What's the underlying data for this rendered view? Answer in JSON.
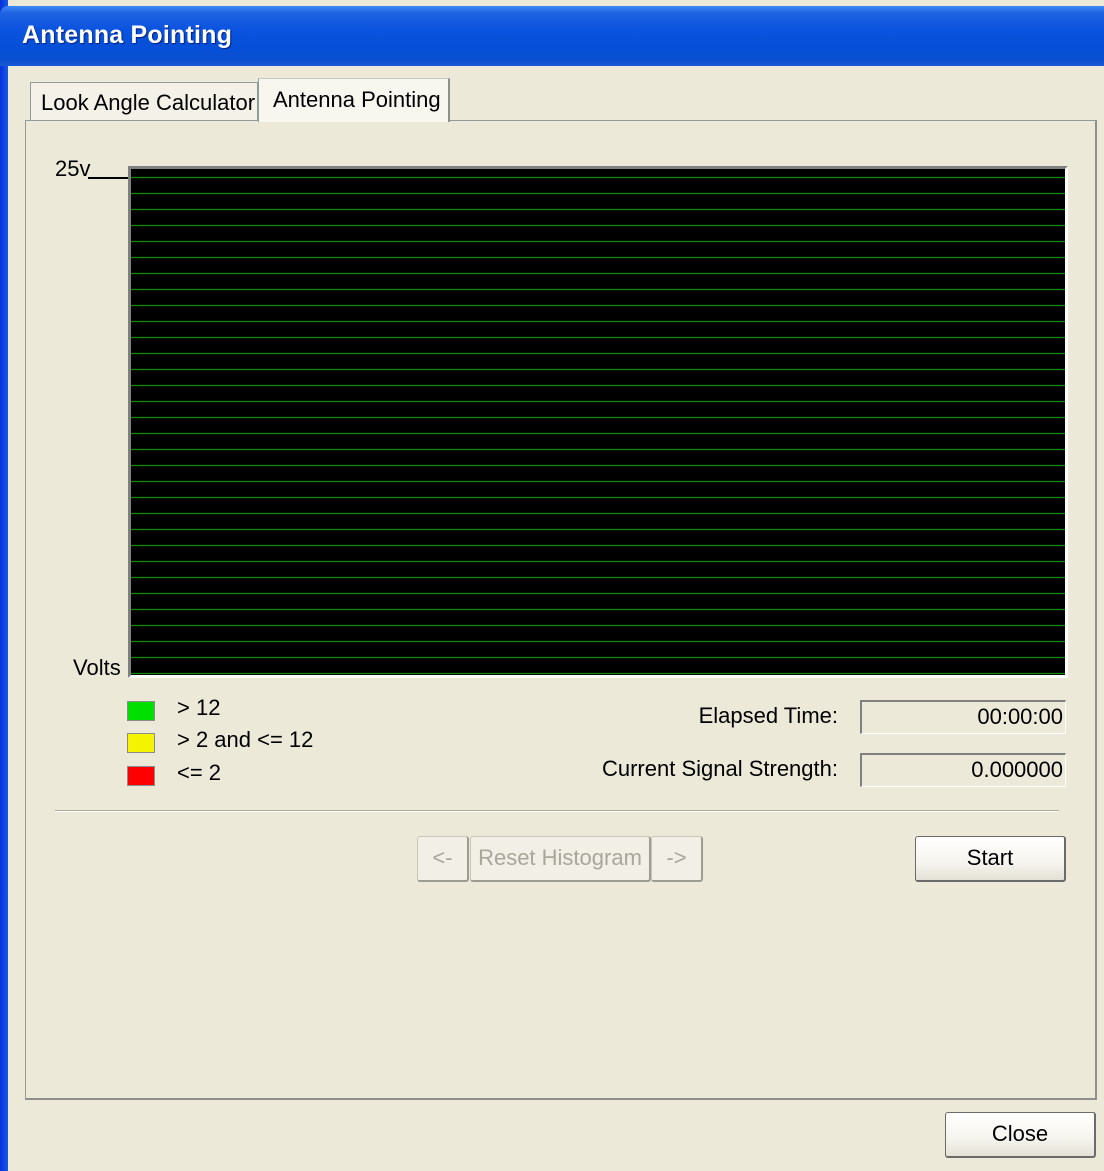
{
  "window": {
    "title": "Antenna Pointing"
  },
  "tabs": [
    {
      "label": "Look Angle Calculator",
      "active": false
    },
    {
      "label": "Antenna Pointing",
      "active": true
    }
  ],
  "chart": {
    "max_label": "25v",
    "unit_label": "Volts"
  },
  "chart_data": {
    "type": "bar",
    "title": "",
    "ylabel": "Volts",
    "ylim": [
      0,
      25
    ],
    "tick_labels": [
      "25v"
    ],
    "values": [],
    "grid": true
  },
  "legend": [
    {
      "label": "> 12",
      "color": "#00e000"
    },
    {
      "label": "> 2 and <= 12",
      "color": "#f4f400"
    },
    {
      "label": "<= 2",
      "color": "#ff0000"
    }
  ],
  "readouts": {
    "elapsed_label": "Elapsed Time:",
    "elapsed_value": "00:00:00",
    "signal_label": "Current Signal Strength:",
    "signal_value": "0.000000"
  },
  "buttons": {
    "prev": "<-",
    "reset": "Reset Histogram",
    "next": "->",
    "start": "Start",
    "close": "Close"
  },
  "colors": {
    "titlebar": "#0a53de",
    "chart_background": "#000000",
    "grid_lines": "#0b8a0b",
    "window_background": "#ece9d8"
  }
}
